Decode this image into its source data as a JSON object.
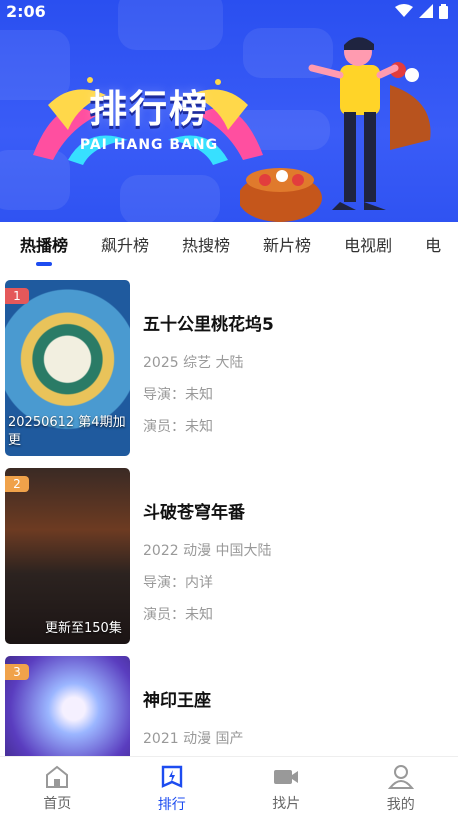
{
  "status_bar": {
    "time": "2:06"
  },
  "banner": {
    "title": "排行榜",
    "subtitle": "PAI HANG BANG"
  },
  "tabs": [
    {
      "label": "热播榜",
      "active": true
    },
    {
      "label": "飙升榜"
    },
    {
      "label": "热搜榜"
    },
    {
      "label": "新片榜"
    },
    {
      "label": "电视剧"
    },
    {
      "label": "电"
    }
  ],
  "rankings": [
    {
      "rank": "1",
      "title": "五十公里桃花坞5",
      "meta": "2025 综艺 大陆",
      "director": "导演：未知",
      "actors": "演员：未知",
      "poster_note": "20250612 第4期加更",
      "rank_color": "#e4585a"
    },
    {
      "rank": "2",
      "title": "斗破苍穹年番",
      "meta": "2022 动漫 中国大陆",
      "director": "导演：内详",
      "actors": "演员：未知",
      "poster_note": "更新至150集",
      "rank_color": "#f0a24a"
    },
    {
      "rank": "3",
      "title": "神印王座",
      "meta": "2021 动漫 国产",
      "director": "",
      "actors": "",
      "poster_note": "",
      "rank_color": "#f0a24a"
    }
  ],
  "bottom_nav": [
    {
      "label": "首页",
      "icon": "home-icon"
    },
    {
      "label": "排行",
      "icon": "ranking-icon",
      "active": true
    },
    {
      "label": "找片",
      "icon": "video-camera-icon"
    },
    {
      "label": "我的",
      "icon": "user-icon"
    }
  ],
  "colors": {
    "accent": "#1d4cf0",
    "banner": "#2f53f2"
  }
}
